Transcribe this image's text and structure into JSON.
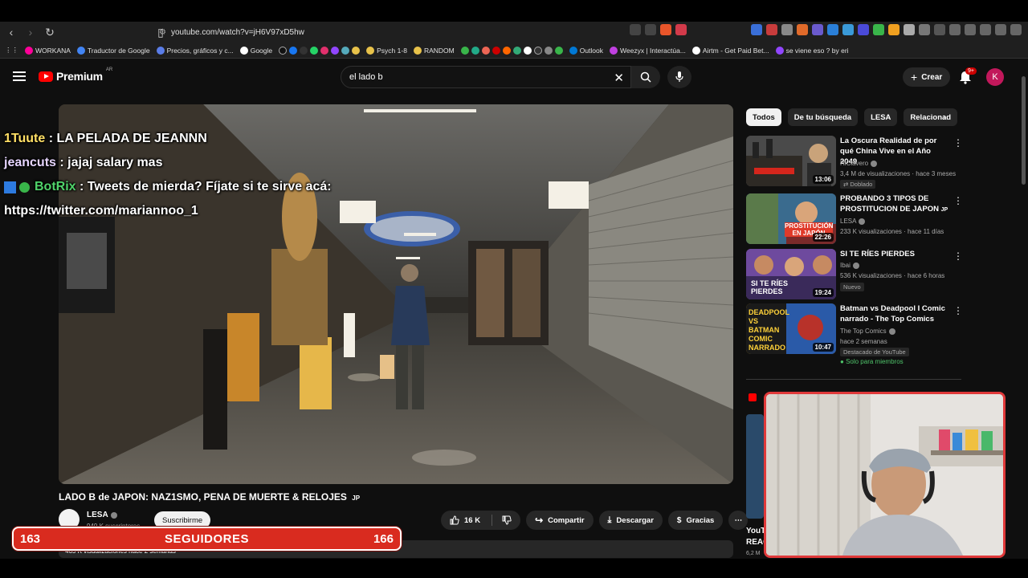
{
  "browser": {
    "url": "youtube.com/watch?v=jH6V97xD5hw",
    "bookmarks": [
      "WORKANA",
      "Traductor de Google",
      "Precios, gráficos y c...",
      "Google",
      "Psych 1-8",
      "RANDOM",
      "Outlook",
      "Weezyx | Interactúa...",
      "Airtm - Get Paid Bet...",
      "se viene eso ? by eri"
    ]
  },
  "youtube": {
    "logo_word": "Premium",
    "country": "AR",
    "search_value": "el lado b",
    "create_label": "Crear",
    "notif_count": "9+",
    "avatar_letter": "K"
  },
  "chat": [
    {
      "user": "1Tuute",
      "text": ": LA PELADA DE JEANNN"
    },
    {
      "user": "jeancuts",
      "text": ": jajaj salary mas"
    },
    {
      "user": "BotRix",
      "text": ": Tweets de mierda? Fíjate si te sirve acá:"
    },
    {
      "user": "",
      "text": "https://twitter.com/mariannoo_1"
    }
  ],
  "video": {
    "title": "LADO B de JAPON: NAZ1SMO, PENA DE MUERTE & RELOJES",
    "title_flag": "JP",
    "channel": "LESA",
    "subscribers": "949 K suscriptores",
    "subscribe_label": "Suscribirme",
    "likes": "16 K",
    "share_label": "Compartir",
    "download_label": "Descargar",
    "thanks_label": "Gracias",
    "desc_meta": "465 K visualizaciones  hace 2 semanas"
  },
  "chips": [
    "Todos",
    "De tu búsqueda",
    "LESA",
    "Relacionad"
  ],
  "recommendations": [
    {
      "title": "La Oscura Realidad de por qué China Vive en el Año 2049",
      "channel": "HiClavero",
      "meta": "3,4 M de visualizaciones · hace 3 meses",
      "badge": "Doblado",
      "duration": "13:06",
      "thumb_color": "#3d3a35"
    },
    {
      "title": "PROBANDO 3 TIPOS DE PROSTITUCION DE JAPON",
      "flag": "JP",
      "channel": "LESA",
      "meta": "233 K visualizaciones · hace 11 días",
      "badge": "",
      "duration": "22:26",
      "thumb_color": "#3a6b8e",
      "thumb_text": "PROSTITUCIÓN EN JAPÓN"
    },
    {
      "title": "SI TE RÍES PIERDES",
      "channel": "Ibai",
      "meta": "536 K visualizaciones · hace 6 horas",
      "badge": "Nuevo",
      "duration": "19:24",
      "thumb_color": "#6e4a9e",
      "thumb_text": "SI TE RÍES PIERDES"
    },
    {
      "title": "Batman vs Deadpool I Comic narrado - The Top Comics",
      "channel": "The Top Comics",
      "meta": "hace 2 semanas",
      "badge": "Destacado de YouTube",
      "members": "Solo para miembros",
      "duration": "10:47",
      "thumb_color": "#c9a227",
      "thumb_text": "DEADPOOL VS BATMAN COMIC NARRADO"
    }
  ],
  "side_peek": {
    "text1": "YouT",
    "text2": "REAC",
    "text3": "6,2 M"
  },
  "followers": {
    "current": "163",
    "label": "SEGUIDORES",
    "goal": "166"
  },
  "colors": {
    "accent": "#ff0000",
    "follower_bar": "#d92b1f",
    "cam_border": "#e0393a",
    "background": "#0f0f0f"
  }
}
